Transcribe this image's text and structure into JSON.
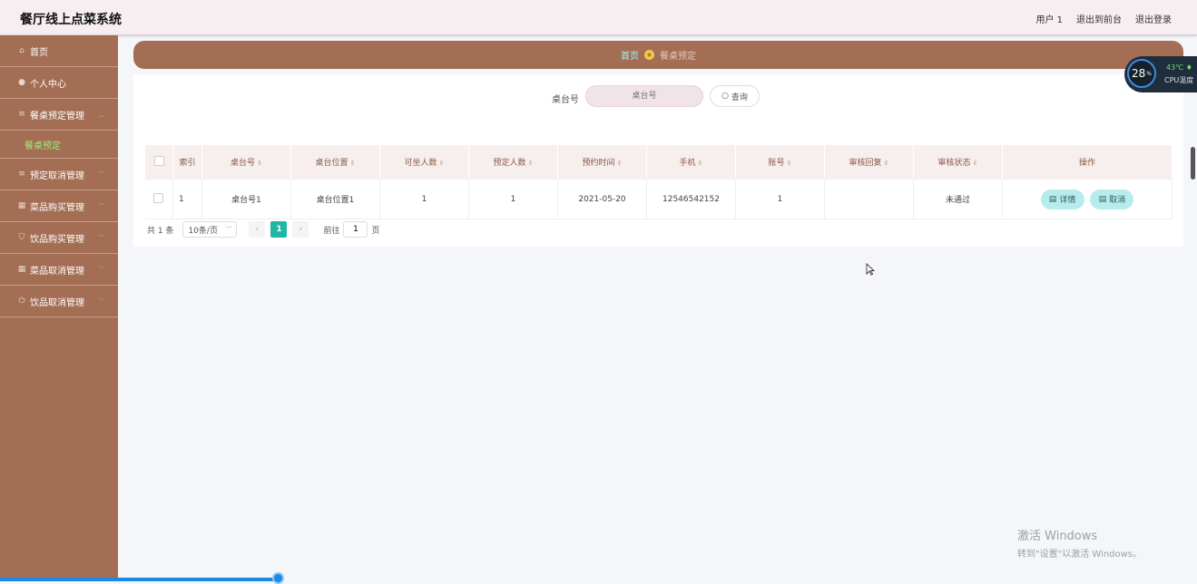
{
  "app": {
    "title": "餐厅线上点菜系统"
  },
  "topbar": {
    "user": "用户 1",
    "to_front": "退出到前台",
    "logout": "退出登录"
  },
  "sidebar": {
    "items": [
      {
        "label": "首页",
        "icon": "home-icon"
      },
      {
        "label": "个人中心",
        "icon": "user-icon"
      },
      {
        "label": "餐桌预定管理",
        "icon": "menu-icon"
      },
      {
        "label": "餐桌预定",
        "sub": true
      },
      {
        "label": "预定取消管理",
        "icon": "menu-icon"
      },
      {
        "label": "菜品购买管理",
        "icon": "grid-icon"
      },
      {
        "label": "饮品购买管理",
        "icon": "shield-icon"
      },
      {
        "label": "菜品取消管理",
        "icon": "grid-icon"
      },
      {
        "label": "饮品取消管理",
        "icon": "power-icon"
      }
    ]
  },
  "breadcrumb": {
    "home": "首页",
    "current": "餐桌预定"
  },
  "search": {
    "label": "桌台号",
    "placeholder": "桌台号",
    "button": "查询"
  },
  "table": {
    "headers": [
      "索引",
      "桌台号",
      "桌台位置",
      "可坐人数",
      "预定人数",
      "预约时间",
      "手机",
      "账号",
      "审核回复",
      "审核状态",
      "操作"
    ],
    "rows": [
      {
        "index": "1",
        "table_no": "桌台号1",
        "location": "桌台位置1",
        "seats": "1",
        "reserved": "1",
        "time": "2021-05-20",
        "phone": "12546542152",
        "account": "1",
        "reply": "",
        "status": "未通过"
      }
    ],
    "actions": {
      "detail": "详情",
      "cancel": "取消"
    }
  },
  "pager": {
    "total": "共 1 条",
    "page_size": "10条/页",
    "current_page": "1",
    "goto_label": "前往",
    "goto_value": "1",
    "page_unit": "页"
  },
  "cpu": {
    "usage": "28",
    "usage_unit": "%",
    "temp": "43℃",
    "label": "CPU温度"
  },
  "watermark": {
    "line1": "激活 Windows",
    "line2": "转到\"设置\"以激活 Windows。"
  }
}
